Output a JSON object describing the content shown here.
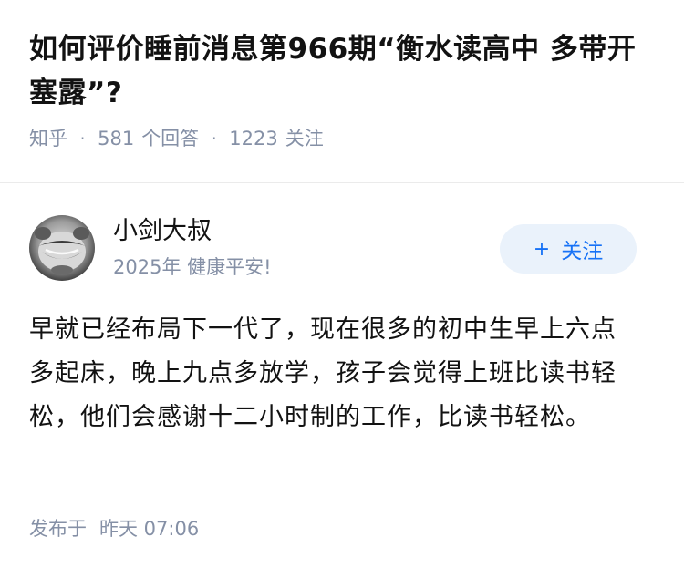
{
  "question": {
    "title": "如何评价睡前消息第966期“衡水读高中 多带开塞露”?",
    "source": "知乎",
    "answer_count": "581",
    "answer_label": "个回答",
    "follower_count": "1223",
    "follower_label": "关注"
  },
  "answer": {
    "author_name": "小剑大叔",
    "author_bio": "2025年 健康平安!",
    "follow_button": "关注",
    "follow_icon": "plus-icon",
    "content": "早就已经布局下一代了，现在很多的初中生早上六点多起床，晚上九点多放学，孩子会觉得上班比读书轻松，他们会感谢十二小时制的工作，比读书轻松。",
    "post_label": "发布于",
    "post_time": "昨天 07:06"
  },
  "colors": {
    "accent": "#1772f6",
    "muted": "#8590a6",
    "button_bg": "#eaf2fb"
  }
}
